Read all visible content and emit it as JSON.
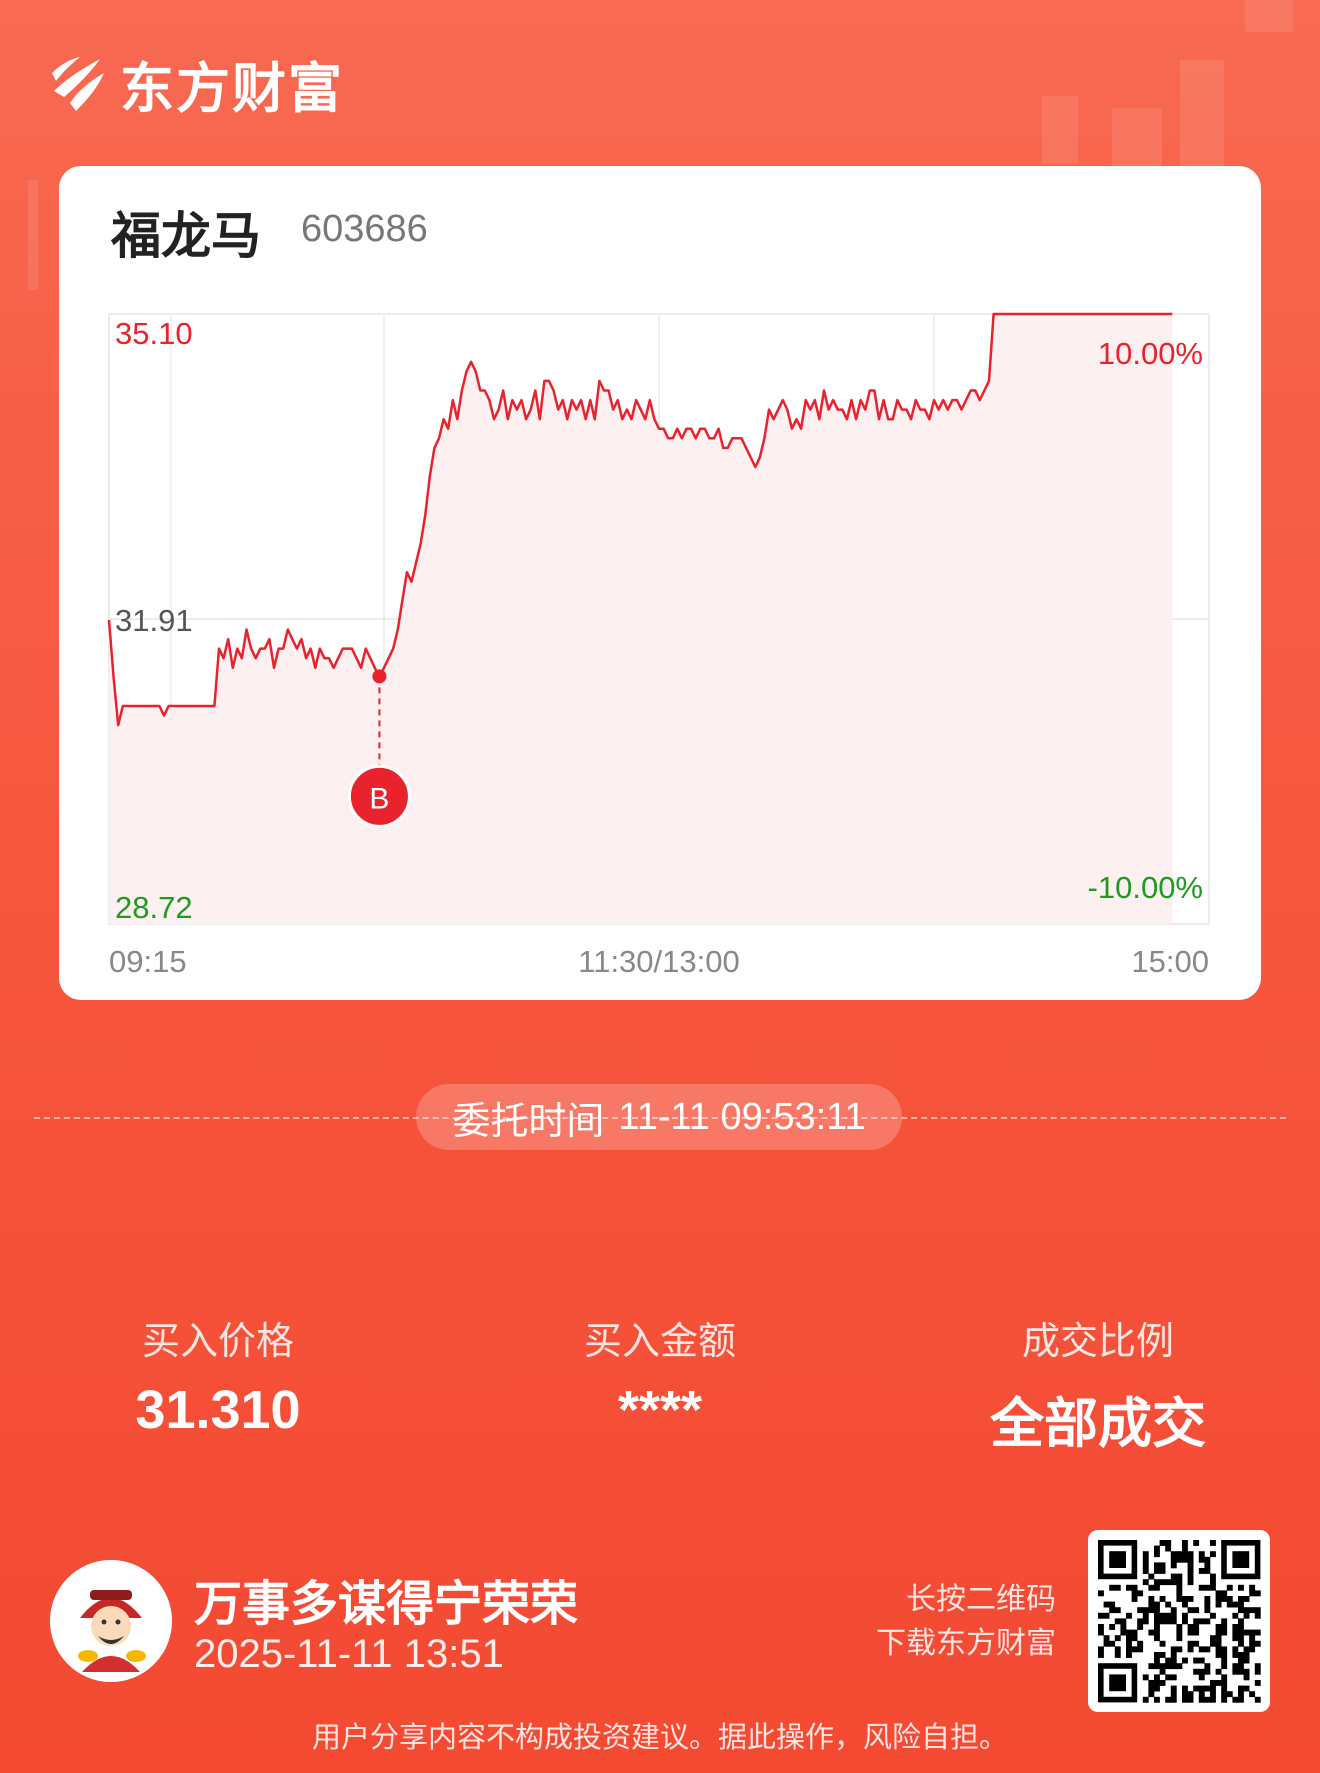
{
  "brand": {
    "name": "东方财富"
  },
  "stock": {
    "name": "福龙马",
    "code": "603686"
  },
  "chart_data": {
    "type": "line",
    "title": "",
    "xlabel": "",
    "ylabel": "",
    "x_ticks": [
      "09:15",
      "11:30/13:00",
      "15:00"
    ],
    "y_left_ticks": [
      "35.10",
      "31.91",
      "28.72"
    ],
    "y_right_ticks": [
      "10.00%",
      "-10.00%"
    ],
    "ylim": [
      28.72,
      35.1
    ],
    "prev_close": 31.91,
    "grid": true,
    "colors": {
      "line": "#e8232e",
      "up": "#e8232e",
      "down": "#1f9a1f",
      "neutral": "#555555",
      "fill": "#fdf0f0"
    },
    "buy_marker": {
      "label": "B",
      "time_index": 59,
      "price": 31.31
    },
    "series": [
      {
        "values": [
          31.9,
          31.3,
          30.8,
          31.0,
          31.0,
          31.0,
          31.0,
          31.0,
          31.0,
          31.0,
          31.0,
          31.0,
          30.9,
          31.0,
          31.0,
          31.0,
          31.0,
          31.0,
          31.0,
          31.0,
          31.0,
          31.0,
          31.0,
          31.0,
          31.6,
          31.5,
          31.7,
          31.4,
          31.6,
          31.5,
          31.8,
          31.6,
          31.5,
          31.6,
          31.6,
          31.7,
          31.4,
          31.6,
          31.6,
          31.8,
          31.7,
          31.6,
          31.7,
          31.5,
          31.6,
          31.4,
          31.6,
          31.5,
          31.5,
          31.4,
          31.5,
          31.6,
          31.6,
          31.6,
          31.5,
          31.4,
          31.6,
          31.5,
          31.4,
          31.3,
          31.4,
          31.5,
          31.6,
          31.8,
          32.1,
          32.4,
          32.3,
          32.5,
          32.7,
          33.0,
          33.4,
          33.7,
          33.8,
          34.0,
          33.9,
          34.2,
          34.0,
          34.3,
          34.5,
          34.6,
          34.5,
          34.3,
          34.3,
          34.2,
          34.0,
          34.1,
          34.3,
          34.0,
          34.2,
          34.1,
          34.2,
          34.0,
          34.1,
          34.3,
          34.0,
          34.4,
          34.4,
          34.3,
          34.1,
          34.2,
          34.0,
          34.2,
          34.1,
          34.2,
          34.0,
          34.2,
          34.0,
          34.4,
          34.3,
          34.3,
          34.1,
          34.2,
          34.0,
          34.1,
          34.0,
          34.2,
          34.1,
          34.0,
          34.2,
          34.0,
          33.9,
          33.9,
          33.8,
          33.8,
          33.9,
          33.8,
          33.9,
          33.9,
          33.8,
          33.9,
          33.9,
          33.8,
          33.8,
          33.9,
          33.7,
          33.7,
          33.8,
          33.8,
          33.8,
          33.7,
          33.6,
          33.5,
          33.6,
          33.8,
          34.1,
          34.0,
          34.1,
          34.2,
          34.1,
          33.9,
          34.0,
          33.9,
          34.2,
          34.1,
          34.2,
          34.0,
          34.3,
          34.1,
          34.2,
          34.1,
          34.1,
          34.0,
          34.2,
          34.0,
          34.2,
          34.1,
          34.3,
          34.3,
          34.0,
          34.2,
          34.0,
          34.0,
          34.2,
          34.1,
          34.1,
          34.0,
          34.2,
          34.1,
          34.1,
          34.0,
          34.2,
          34.1,
          34.2,
          34.1,
          34.2,
          34.2,
          34.1,
          34.2,
          34.3,
          34.3,
          34.2,
          34.3,
          34.4,
          35.1,
          35.1,
          35.1,
          35.1,
          35.1,
          35.1,
          35.1,
          35.1,
          35.1,
          35.1,
          35.1,
          35.1,
          35.1,
          35.1,
          35.1,
          35.1,
          35.1,
          35.1,
          35.1,
          35.1,
          35.1,
          35.1,
          35.1,
          35.1,
          35.1,
          35.1,
          35.1,
          35.1,
          35.1,
          35.1,
          35.1,
          35.1,
          35.1,
          35.1,
          35.1,
          35.1,
          35.1,
          35.1,
          35.1,
          35.1
        ]
      }
    ]
  },
  "order": {
    "label": "委托时间",
    "datetime": "11-11 09:53:11"
  },
  "stats": [
    {
      "label": "买入价格",
      "value": "31.310"
    },
    {
      "label": "买入金额",
      "value": "****"
    },
    {
      "label": "成交比例",
      "value": "全部成交"
    }
  ],
  "user": {
    "name": "万事多谋得宁荣荣",
    "date": "2025-11-11 13:51"
  },
  "qr_hint": {
    "line1": "长按二维码",
    "line2": "下载东方财富"
  },
  "disclaimer": "用户分享内容不构成投资建议。据此操作，风险自担。"
}
